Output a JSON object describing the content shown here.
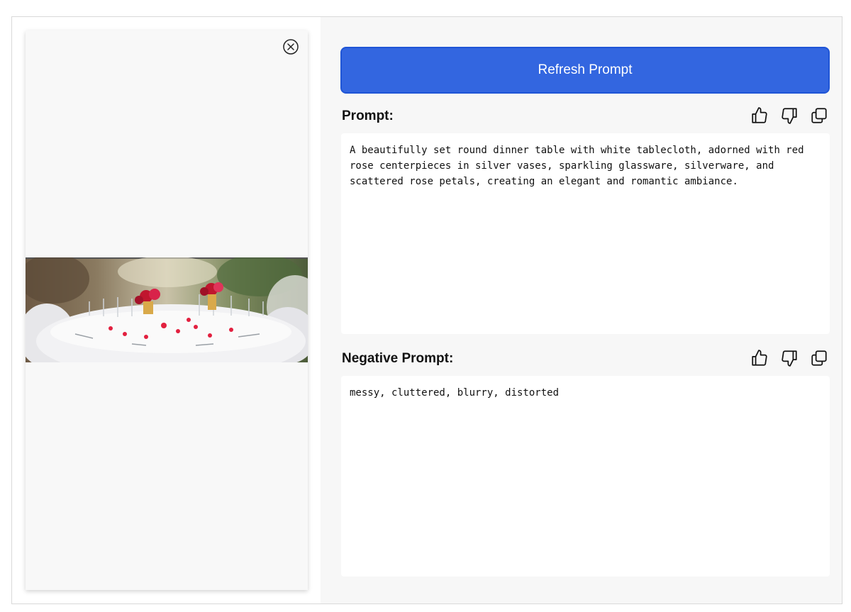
{
  "image_viewer": {
    "close_icon": "circle-x-icon",
    "photo_alt": "round dinner table with red rose centerpieces"
  },
  "toolbar": {
    "refresh_label": "Refresh Prompt"
  },
  "prompt": {
    "label": "Prompt:",
    "text": "A beautifully set round dinner table with white tablecloth, adorned with red rose centerpieces in silver vases, sparkling glassware, silverware, and scattered rose petals, creating an elegant and romantic ambiance.",
    "icons": [
      "thumbs-up-icon",
      "thumbs-down-icon",
      "copy-icon"
    ]
  },
  "negative_prompt": {
    "label": "Negative Prompt:",
    "text": "messy, cluttered, blurry, distorted",
    "icons": [
      "thumbs-up-icon",
      "thumbs-down-icon",
      "copy-icon"
    ]
  },
  "colors": {
    "accent": "#3366e0",
    "panel_bg": "#f7f7f7"
  }
}
